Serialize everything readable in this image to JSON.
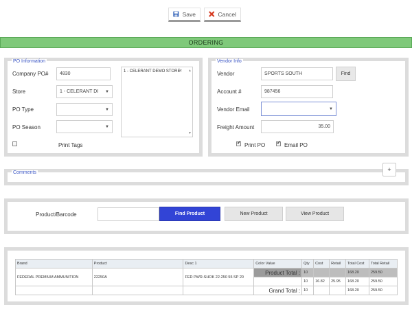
{
  "toolbar": {
    "save_label": "Save",
    "cancel_label": "Cancel"
  },
  "banner": {
    "title": "ORDERING"
  },
  "po_info": {
    "legend": "PO Information",
    "company_po_label": "Company PO#",
    "company_po_value": "4830",
    "store_label": "Store",
    "store_value": "1 - CELERANT DI",
    "po_type_label": "PO Type",
    "po_type_value": "",
    "po_season_label": "PO Season",
    "po_season_value": "",
    "print_tags_label": "Print Tags",
    "print_tags_checked": false,
    "store_list": [
      "1 - CELERANT DEMO STORE"
    ],
    "remove_symbol": "×"
  },
  "vendor_info": {
    "legend": "Vendor Info",
    "vendor_label": "Vendor",
    "vendor_value": "SPORTS SOUTH",
    "find_label": "Find",
    "account_label": "Account #",
    "account_value": "987456",
    "email_label": "Vendor Email",
    "email_value": "",
    "freight_label": "Freight Amount",
    "freight_value": "35.00",
    "print_po_label": "Print PO",
    "print_po_checked": true,
    "email_po_label": "Email PO",
    "email_po_checked": true
  },
  "comments": {
    "legend": "Comments",
    "expand_symbol": "+"
  },
  "product": {
    "barcode_label": "Product/Barcode",
    "barcode_value": "",
    "find_label": "Find Product",
    "new_label": "New Product",
    "view_label": "View Product"
  },
  "grid": {
    "headers": [
      "Brand",
      "Product",
      "Desc 1",
      "Color Value",
      "Qty",
      "Cost",
      "Retail",
      "Total Cost",
      "Total Retail"
    ],
    "row": {
      "brand": "FEDERAL PREMIUM AMMUNITION",
      "product": "22250A",
      "desc": "FED PWR-SHOK 22-250 55 SP 20",
      "product_total_label": "Product Total :",
      "product_total_qty": "10",
      "product_total_cost": "168.20",
      "product_total_retail": "259.50",
      "line_qty": "10",
      "line_cost": "16.82",
      "line_retail": "25.95",
      "line_total_cost": "168.20",
      "line_total_retail": "259.50"
    },
    "grand_total": {
      "label": "Grand Total :",
      "qty": "10",
      "total_cost": "168.20",
      "total_retail": "259.50"
    }
  },
  "colors": {
    "banner": "#7fc97a",
    "primary_button": "#3244d6",
    "legend_text": "#3a55c4"
  }
}
